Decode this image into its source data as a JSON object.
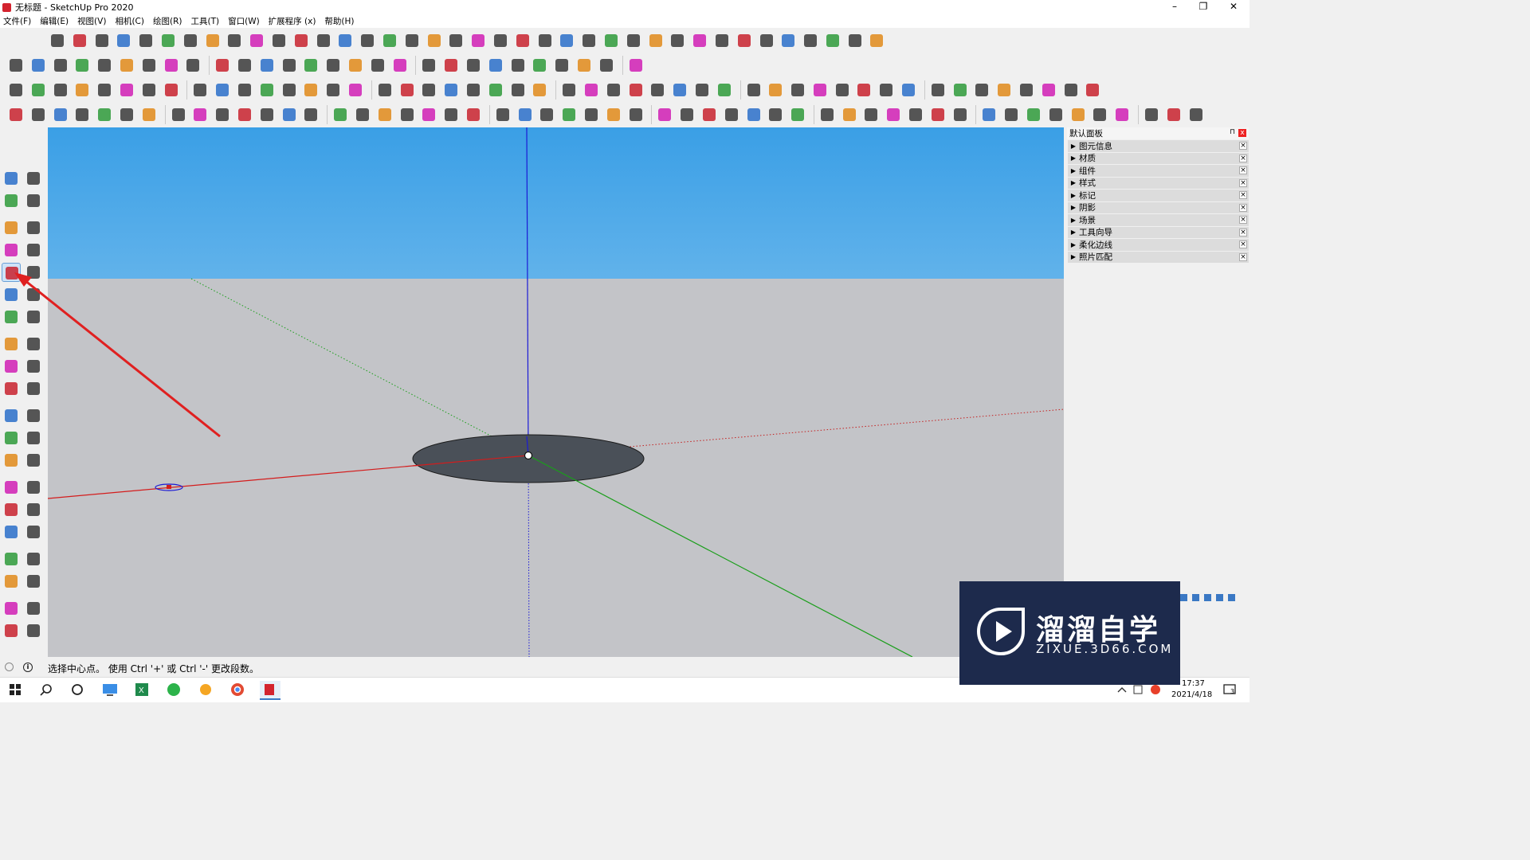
{
  "window": {
    "title": "无标题 - SketchUp Pro 2020",
    "minimize": "–",
    "restore": "❐",
    "close": "✕"
  },
  "menu": [
    "文件(F)",
    "编辑(E)",
    "视图(V)",
    "相机(C)",
    "绘图(R)",
    "工具(T)",
    "窗口(W)",
    "扩展程序 (x)",
    "帮助(H)"
  ],
  "toolbars": {
    "row1_count": 38,
    "row2_count": 28,
    "row3_count": 48,
    "row4_count": 52,
    "vertical_count": 42,
    "colors": {
      "red": "#c8222e",
      "dark": "#3a3a3a",
      "blue": "#2a6fc9",
      "green": "#2e9a3a",
      "orange": "#e08a1a",
      "magenta": "#d01fb4"
    }
  },
  "tray": {
    "title": "默认面板",
    "close_label": "x",
    "pin_label": "⊓",
    "items": [
      "图元信息",
      "材质",
      "组件",
      "样式",
      "标记",
      "阴影",
      "场景",
      "工具向导",
      "柔化边线",
      "照片匹配"
    ]
  },
  "status": {
    "text": "选择中心点。 使用 Ctrl '+' 或 Ctrl '-' 更改段数。",
    "info_icon": "i"
  },
  "viewport": {
    "sky_top": "#3a9fe6",
    "ground": "#c3c4c8",
    "disc_fill": "#4a5058",
    "red_axis": "#d41c1c",
    "green_axis": "#1a9e1a",
    "blue_axis": "#1a1ad6"
  },
  "watermark": {
    "brand": "溜溜自学",
    "url": "ZIXUE.3D66.COM"
  },
  "clock": {
    "time": "17:37",
    "date": "2021/4/18"
  },
  "taskbar": {
    "notification_count": "3"
  }
}
